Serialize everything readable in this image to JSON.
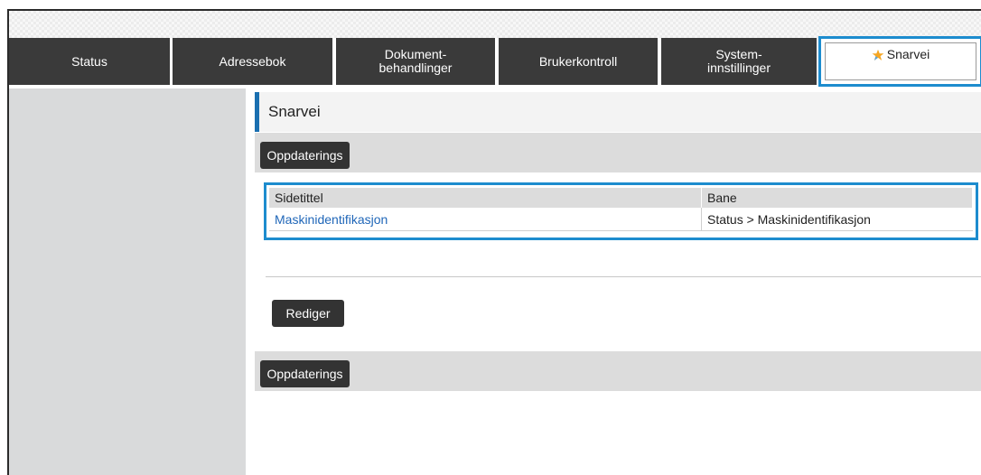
{
  "tabs": [
    {
      "label": "Status"
    },
    {
      "label": "Adressebok"
    },
    {
      "label": "Dokument-\nbehandlinger"
    },
    {
      "label": "Brukerkontroll"
    },
    {
      "label": "System-\ninnstillinger"
    },
    {
      "label": "Snarvei",
      "icon": "star-icon",
      "active": true
    }
  ],
  "page": {
    "title": "Snarvei",
    "update_button_top": "Oppdaterings",
    "update_button_bottom": "Oppdaterings",
    "edit_button": "Rediger"
  },
  "table": {
    "headers": [
      "Sidetittel",
      "Bane"
    ],
    "rows": [
      {
        "page_title": "Maskinidentifikasjon",
        "path": "Status > Maskinidentifikasjon"
      }
    ]
  },
  "colors": {
    "tab_bg": "#3a3a3a",
    "highlight": "#1d8cce",
    "title_accent": "#1a6fb0",
    "link": "#1f66b8",
    "star": "#f5a623"
  }
}
